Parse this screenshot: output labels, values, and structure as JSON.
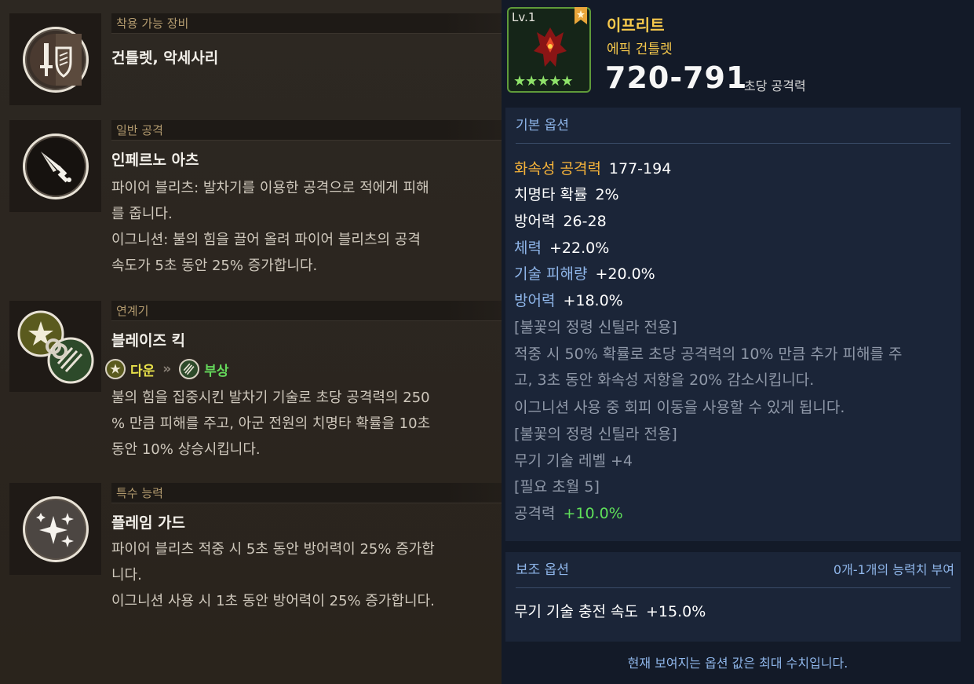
{
  "left": {
    "equip": {
      "header": "착용 가능 장비",
      "name": "건틀렛, 악세사리"
    },
    "normal_attack": {
      "header": "일반 공격",
      "name": "인페르노 아츠",
      "lines": [
        "파이어 블리츠: 발차기를 이용한 공격으로 적에게 피해",
        "를 줍니다.",
        "이그니션: 불의 힘을 끌어 올려 파이어 블리츠의 공격",
        "속도가 5초 동안 25% 증가합니다."
      ]
    },
    "chain": {
      "header": "연계기",
      "name": "블레이즈 킥",
      "from": "다운",
      "to": "부상",
      "lines": [
        "불의 힘을 집중시킨 발차기 기술로 초당 공격력의 250",
        "% 만큼 피해를 주고, 아군 전원의 치명타 확률을 10초",
        "동안 10% 상승시킵니다."
      ]
    },
    "special": {
      "header": "특수 능력",
      "name": "플레임 가드",
      "lines": [
        "파이어 블리츠 적중 시 5초 동안 방어력이 25% 증가합",
        "니다.",
        "이그니션 사용 시 1초 동안 방어력이 25% 증가합니다."
      ]
    }
  },
  "item": {
    "level_label": "Lv.",
    "level": "1",
    "stars": "★★★★★",
    "name": "이프리트",
    "type": "에픽 건틀렛",
    "attack": "720-791",
    "attack_label": "초당 공격력"
  },
  "basic": {
    "title": "기본 옵션",
    "opts": [
      {
        "k": "화속성 공격력",
        "v": "177-194",
        "color": "#f7b43a"
      },
      {
        "k": "치명타 확률",
        "v": "2%",
        "color": "#ffffff"
      },
      {
        "k": "방어력",
        "v": "26-28",
        "color": "#ffffff"
      },
      {
        "k": "체력",
        "v": "+22.0%",
        "color": "#8fb6ea"
      },
      {
        "k": "기술 피해량",
        "v": "+20.0%",
        "color": "#8fb6ea"
      },
      {
        "k": "방어력",
        "v": "+18.0%",
        "color": "#8fb6ea"
      }
    ],
    "muted_lines": [
      "[불꽃의 정령 신틸라 전용]",
      "적중 시 50% 확률로 초당 공격력의 10% 만큼 추가 피해를 주",
      "고, 3초 동안 화속성 저항을 20% 감소시킵니다.",
      "이그니션 사용 중 회피 이동을 사용할 수 있게 됩니다.",
      "[불꽃의 정령 신틸라 전용]",
      "무기 기술 레벨 +4",
      "[필요 초월 5]"
    ],
    "last": {
      "k": "공격력",
      "v": "+10.0%"
    }
  },
  "aux": {
    "title": "보조 옵션",
    "note": "0개-1개의 능력치 부여",
    "opt": {
      "k": "무기 기술 충전 속도",
      "v": "+15.0%"
    }
  },
  "footer": "현재 보여지는 옵션 값은 최대 수치입니다."
}
